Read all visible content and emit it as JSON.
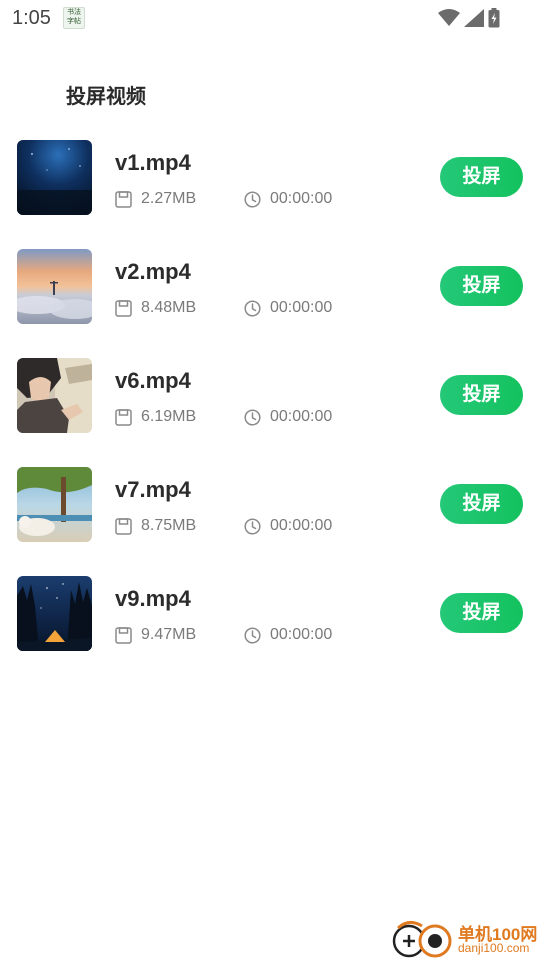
{
  "status_bar": {
    "time": "1:05",
    "app_icon_text": "书法\n字帖"
  },
  "page": {
    "title": "投屏视频"
  },
  "videos": [
    {
      "name": "v1.mp4",
      "size": "2.27MB",
      "duration": "00:00:00",
      "button": "投屏",
      "thumb": "night-ocean"
    },
    {
      "name": "v2.mp4",
      "size": "8.48MB",
      "duration": "00:00:00",
      "button": "投屏",
      "thumb": "sunset-clouds"
    },
    {
      "name": "v6.mp4",
      "size": "6.19MB",
      "duration": "00:00:00",
      "button": "投屏",
      "thumb": "anime-boy"
    },
    {
      "name": "v7.mp4",
      "size": "8.75MB",
      "duration": "00:00:00",
      "button": "投屏",
      "thumb": "dog-beach"
    },
    {
      "name": "v9.mp4",
      "size": "9.47MB",
      "duration": "00:00:00",
      "button": "投屏",
      "thumb": "starry-camp"
    }
  ],
  "icons": {
    "size": "floppy-disk-icon",
    "duration": "clock-icon"
  },
  "colors": {
    "button": "#16c35f",
    "text_primary": "#2c2c2c",
    "text_secondary": "#7a7a7a"
  },
  "watermark": {
    "title": "单机100网",
    "url": "danji100.com"
  }
}
